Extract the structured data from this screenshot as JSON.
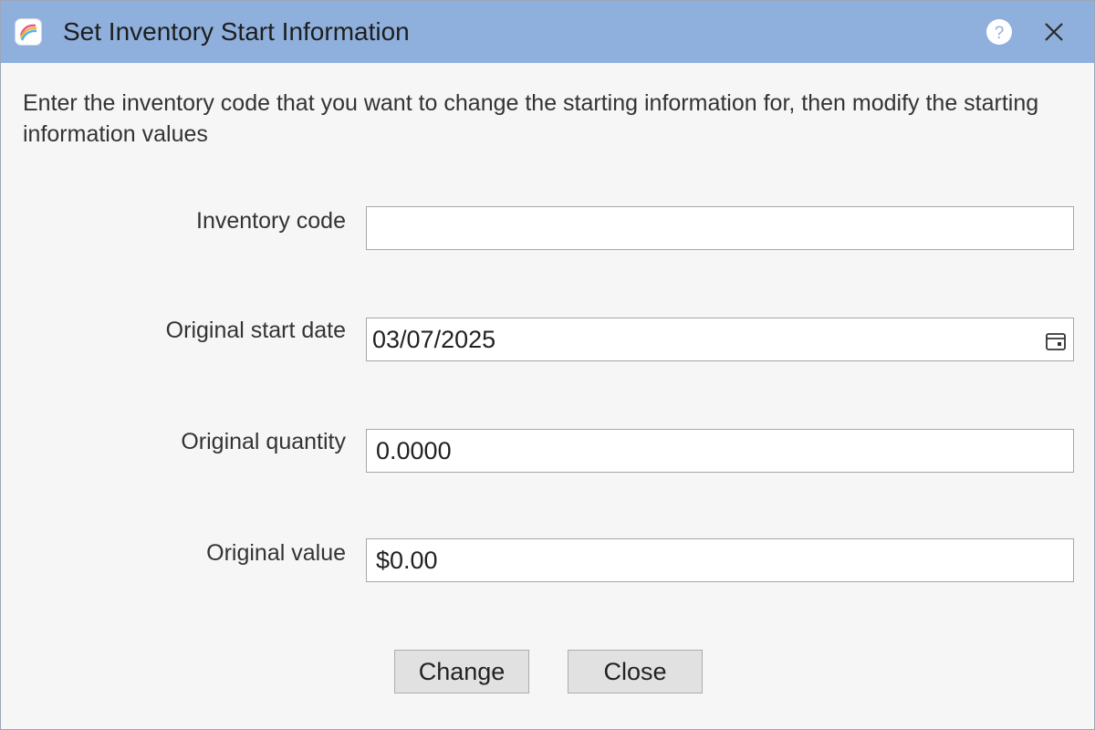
{
  "window": {
    "title": "Set Inventory Start Information",
    "app_icon": "app-logo-icon",
    "help_icon": "help-icon",
    "close_icon": "close-icon",
    "titlebar_color": "#8fb0dc"
  },
  "instructions": "Enter the inventory code that you want to change the starting information for, then modify the starting information values",
  "fields": {
    "inventory_code": {
      "label": "Inventory code",
      "value": ""
    },
    "start_date": {
      "label": "Original start date",
      "value": "03/07/2025",
      "icon": "calendar-icon"
    },
    "quantity": {
      "label": "Original quantity",
      "value": "0.0000"
    },
    "value": {
      "label": "Original value",
      "value": "$0.00"
    }
  },
  "buttons": {
    "change": "Change",
    "close": "Close"
  }
}
